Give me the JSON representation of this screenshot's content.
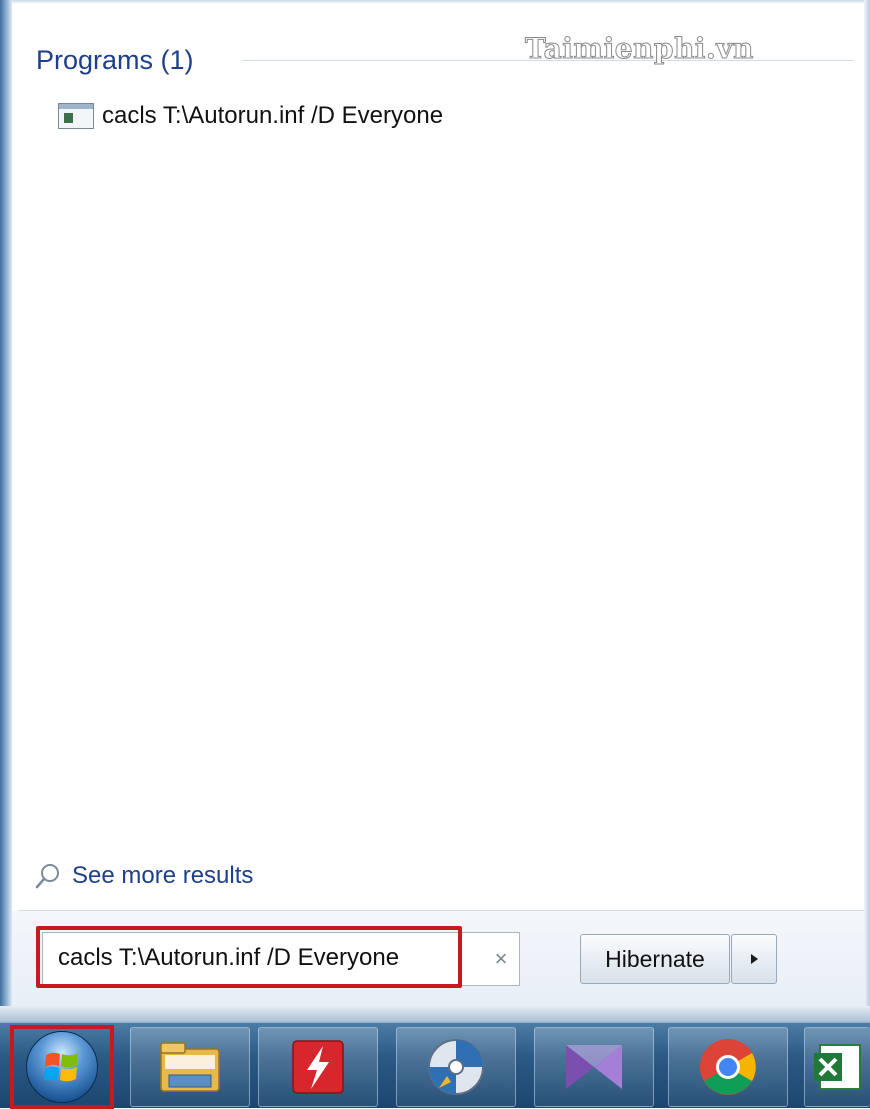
{
  "watermark": "Taimienphi.vn",
  "programs": {
    "heading": "Programs (1)",
    "items": [
      {
        "label": "cacls T:\\Autorun.inf /D Everyone",
        "icon": "console-window-icon"
      }
    ]
  },
  "see_more": {
    "label": "See more results",
    "icon": "search-icon"
  },
  "search": {
    "value": "cacls T:\\Autorun.inf /D Everyone",
    "clear_icon": "×"
  },
  "power": {
    "hibernate_label": "Hibernate",
    "menu_icon": "▸"
  },
  "taskbar": {
    "items": [
      {
        "name": "start-orb",
        "icon": "windows-logo-icon"
      },
      {
        "name": "windows-explorer",
        "icon": "folder-icon"
      },
      {
        "name": "flash-app",
        "icon": "lightning-icon"
      },
      {
        "name": "media-app",
        "icon": "disc-icon"
      },
      {
        "name": "visual-studio",
        "icon": "visual-studio-icon"
      },
      {
        "name": "chrome",
        "icon": "chrome-icon"
      },
      {
        "name": "excel",
        "icon": "excel-icon"
      }
    ]
  },
  "colors": {
    "heading_blue": "#1e3f8a",
    "highlight_red": "#c8191f",
    "taskbar_blue": "#2b5a85"
  }
}
